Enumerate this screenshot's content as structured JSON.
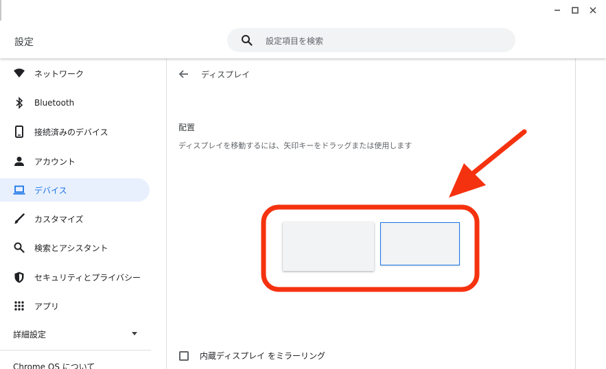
{
  "window": {
    "minimize_icon": "minimize-icon",
    "maximize_icon": "maximize-icon",
    "close_icon": "close-icon"
  },
  "header": {
    "title": "設定",
    "search_placeholder": "設定項目を検索"
  },
  "sidebar": {
    "items": [
      {
        "label": "ネットワーク",
        "icon": "wifi-icon"
      },
      {
        "label": "Bluetooth",
        "icon": "bluetooth-icon"
      },
      {
        "label": "接続済みのデバイス",
        "icon": "phone-icon"
      },
      {
        "label": "アカウント",
        "icon": "person-icon"
      },
      {
        "label": "デバイス",
        "icon": "laptop-icon",
        "active": true
      },
      {
        "label": "カスタマイズ",
        "icon": "brush-icon"
      },
      {
        "label": "検索とアシスタント",
        "icon": "search-icon"
      },
      {
        "label": "セキュリティとプライバシー",
        "icon": "shield-icon"
      },
      {
        "label": "アプリ",
        "icon": "apps-grid-icon"
      }
    ],
    "advanced_label": "詳細設定",
    "about_label": "Chrome OS について"
  },
  "main": {
    "page_title": "ディスプレイ",
    "section_title": "配置",
    "section_description": "ディスプレイを移動するには、矢印キーをドラッグまたは使用します",
    "mirror_label": "内蔵ディスプレイ をミラーリング",
    "mirror_checked": false
  },
  "colors": {
    "accent": "#1a73e8",
    "active_bg": "#e8f0fe",
    "annotation": "#f5320f"
  }
}
